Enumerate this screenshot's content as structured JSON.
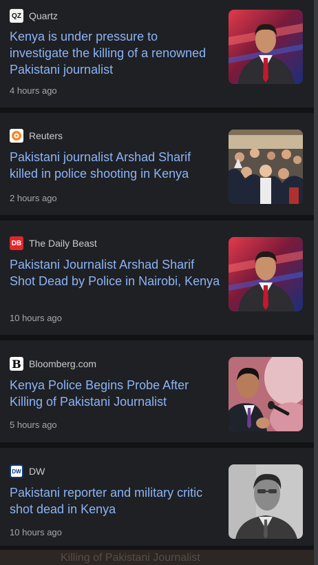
{
  "articles": [
    {
      "source": "Quartz",
      "logo_text": "QZ",
      "headline": "Kenya is under pressure to investigate the killing of a renowned Pakistani journalist",
      "time": "4 hours ago",
      "image": "man-in-suit-studio"
    },
    {
      "source": "Reuters",
      "logo_text": "",
      "headline": "Pakistani journalist Arshad Sharif killed in police shooting in Kenya",
      "time": "2 hours ago",
      "image": "crowd-photo"
    },
    {
      "source": "The Daily Beast",
      "logo_text": "DB",
      "headline": "Pakistani Journalist Arshad Sharif Shot Dead by Police in Nairobi, Kenya",
      "time": "10 hours ago",
      "image": "man-in-suit-studio"
    },
    {
      "source": "Bloomberg.com",
      "logo_text": "B",
      "headline": "Kenya Police Begins Probe After Killing of Pakistani Journalist",
      "time": "5 hours ago",
      "image": "man-with-microphone"
    },
    {
      "source": "DW",
      "logo_text": "DW",
      "headline": "Pakistani reporter and military critic shot dead in Kenya",
      "time": "10 hours ago",
      "image": "grayscale-portrait"
    }
  ],
  "bottom_ghost_text": "Killing of Pakistani Journalist"
}
